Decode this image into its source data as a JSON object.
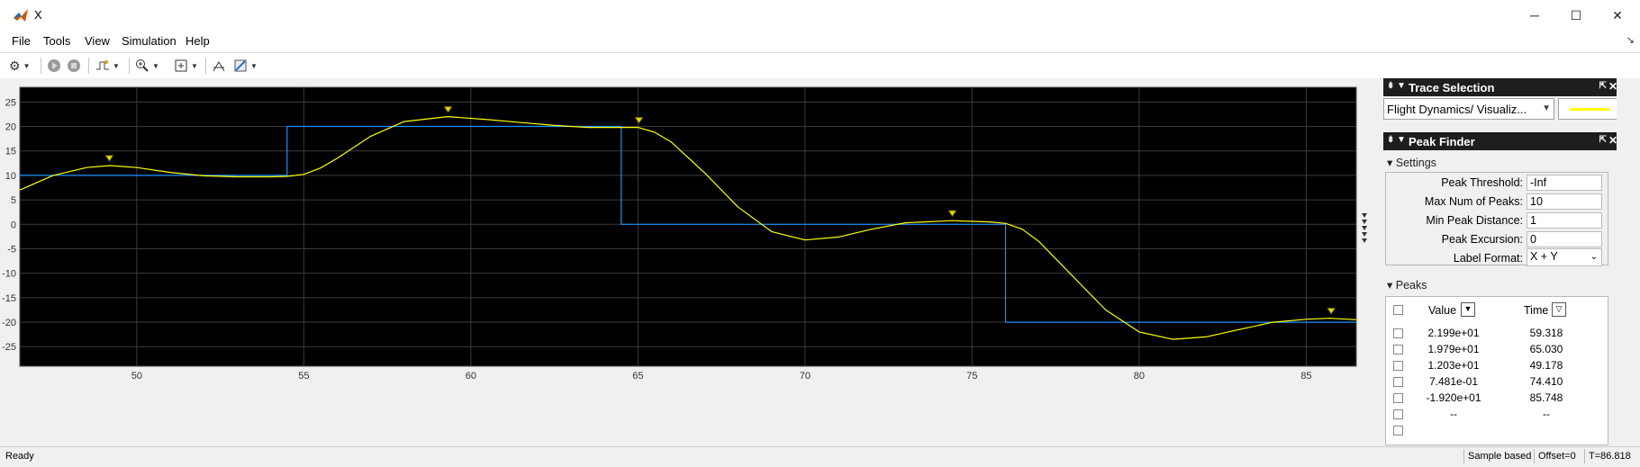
{
  "window": {
    "title": "X"
  },
  "window_controls": {
    "minimize": "─",
    "maximize": "☐",
    "close": "✕"
  },
  "menu": {
    "items": [
      "File",
      "Tools",
      "View",
      "Simulation",
      "Help"
    ]
  },
  "toolbar": {
    "icons": [
      "gear-icon",
      "run-icon",
      "stop-icon",
      "trigger-icon",
      "zoom-icon",
      "fit-icon",
      "measure-icon",
      "style-icon"
    ]
  },
  "trace_selection": {
    "title": "Trace Selection",
    "selected": "Flight Dynamics/ Visualiz...",
    "trace_color": "#ffff00"
  },
  "peak_finder": {
    "title": "Peak Finder",
    "settings_label": "Settings",
    "settings": [
      {
        "label": "Peak Threshold:",
        "value": "-Inf"
      },
      {
        "label": "Max Num of Peaks:",
        "value": "10"
      },
      {
        "label": "Min Peak Distance:",
        "value": "1"
      },
      {
        "label": "Peak Excursion:",
        "value": "0"
      },
      {
        "label": "Label Format:",
        "value": "X + Y"
      }
    ],
    "peaks_label": "Peaks",
    "columns": {
      "value": "Value",
      "time": "Time"
    },
    "rows": [
      {
        "value": "2.199e+01",
        "time": "59.318"
      },
      {
        "value": "1.979e+01",
        "time": "65.030"
      },
      {
        "value": "1.203e+01",
        "time": "49.178"
      },
      {
        "value": "7.481e-01",
        "time": "74.410"
      },
      {
        "value": "-1.920e+01",
        "time": "85.748"
      },
      {
        "value": "--",
        "time": "--"
      }
    ]
  },
  "status": {
    "left": "Ready",
    "mode": "Sample based",
    "offset": "Offset=0",
    "time": "T=86.818"
  },
  "chart_data": {
    "type": "line",
    "xlim": [
      46.5,
      86.5
    ],
    "ylim": [
      -29,
      28
    ],
    "x_ticks": [
      50,
      55,
      60,
      65,
      70,
      75,
      80,
      85
    ],
    "y_ticks": [
      25,
      20,
      15,
      10,
      5,
      0,
      -5,
      -10,
      -15,
      -20,
      -25
    ],
    "grid": true,
    "background": "#000000",
    "series": [
      {
        "color": "#1e90ff",
        "step": true,
        "x": [
          46.5,
          54.5,
          54.5,
          64.5,
          64.5,
          76.0,
          76.0,
          86.5
        ],
        "y": [
          10,
          10,
          20,
          20,
          0,
          0,
          -20,
          -20
        ]
      },
      {
        "color": "#ffff00",
        "x": [
          46.5,
          47.5,
          48.5,
          49.2,
          50.0,
          51.0,
          52.0,
          53.0,
          54.0,
          54.5,
          55.0,
          55.5,
          56.0,
          57.0,
          58.0,
          59.3,
          60.5,
          61.5,
          62.5,
          63.5,
          64.5,
          65.0,
          65.5,
          66.0,
          67.0,
          68.0,
          69.0,
          70.0,
          71.0,
          72.0,
          73.0,
          74.4,
          75.0,
          75.5,
          76.0,
          76.5,
          77.0,
          78.0,
          79.0,
          80.0,
          81.0,
          82.0,
          83.0,
          84.0,
          85.0,
          85.7,
          86.5
        ],
        "y": [
          7,
          10,
          11.6,
          12.0,
          11.6,
          10.6,
          9.9,
          9.7,
          9.7,
          9.8,
          10.2,
          11.5,
          13.5,
          18.0,
          21.0,
          22.0,
          21.4,
          20.8,
          20.2,
          19.8,
          19.8,
          19.8,
          18.8,
          16.8,
          10.5,
          3.5,
          -1.5,
          -3.2,
          -2.6,
          -1.0,
          0.3,
          0.75,
          0.6,
          0.5,
          0.2,
          -1.0,
          -3.5,
          -10.5,
          -17.5,
          -22.0,
          -23.5,
          -23.0,
          -21.5,
          -20.0,
          -19.4,
          -19.2,
          -19.5
        ]
      }
    ],
    "peaks": [
      {
        "x": 49.178,
        "y": 12.03
      },
      {
        "x": 59.318,
        "y": 21.99
      },
      {
        "x": 65.03,
        "y": 19.79
      },
      {
        "x": 74.41,
        "y": 0.7481
      },
      {
        "x": 85.748,
        "y": -19.2
      }
    ]
  }
}
